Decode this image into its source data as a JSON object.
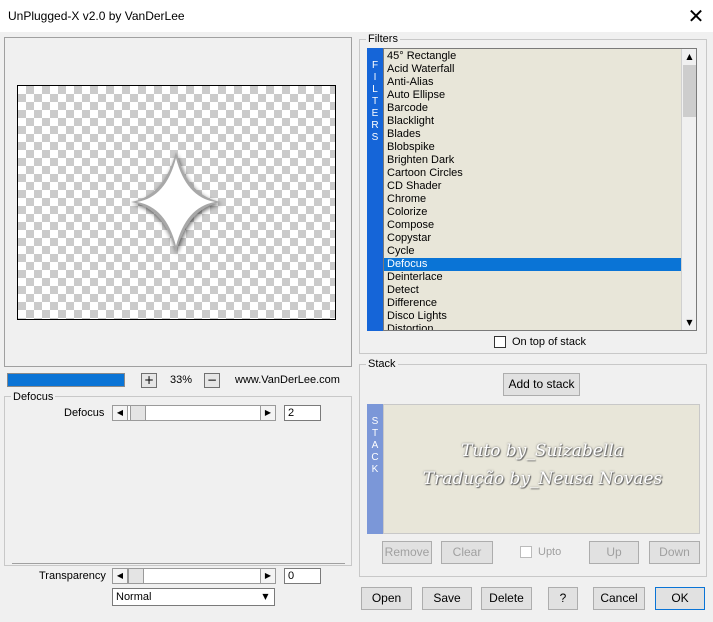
{
  "window": {
    "title": "UnPlugged-X v2.0 by VanDerLee",
    "close_glyph": "✕"
  },
  "preview": {
    "progress_percent": 100
  },
  "zoom": {
    "plus": "+",
    "minus": "−",
    "value": "33%"
  },
  "website": "www.VanDerLee.com",
  "defocus_group": {
    "label": "Defocus",
    "param_label": "Defocus",
    "param_value": "2",
    "slider_position": 0.02
  },
  "transparency": {
    "label": "Transparency",
    "value": "0",
    "slider_position": 0.0
  },
  "blend_mode": {
    "value": "Normal"
  },
  "filters_group": {
    "label": "Filters",
    "band_letters": [
      "F",
      "I",
      "L",
      "T",
      "E",
      "R",
      "S"
    ],
    "items": [
      "45° Rectangle",
      "Acid Waterfall",
      "Anti-Alias",
      "Auto Ellipse",
      "Barcode",
      "Blacklight",
      "Blades",
      "Blobspike",
      "Brighten Dark",
      "Cartoon Circles",
      "CD Shader",
      "Chrome",
      "Colorize",
      "Compose",
      "Copystar",
      "Cycle",
      "Defocus",
      "Deinterlace",
      "Detect",
      "Difference",
      "Disco Lights",
      "Distortion"
    ],
    "selected": "Defocus",
    "on_top_label": "On top of stack",
    "on_top_checked": false
  },
  "stack_group": {
    "label": "Stack",
    "band_letters": [
      "S",
      "T",
      "A",
      "C",
      "K"
    ],
    "add_label": "Add to stack",
    "watermark_line1": "Tuto by_Suizabella",
    "watermark_line2": "Tradução by_Neusa Novaes",
    "remove_label": "Remove",
    "clear_label": "Clear",
    "upto_label": "Upto",
    "up_label": "Up",
    "down_label": "Down"
  },
  "footer": {
    "open": "Open",
    "save": "Save",
    "delete": "Delete",
    "help": "?",
    "cancel": "Cancel",
    "ok": "OK"
  },
  "colors": {
    "accent": "#0a74d6",
    "filters_band": "#1565d8",
    "stack_band": "#7b97d8",
    "list_bg": "#e8e6d9"
  },
  "icons": {
    "left": "◀",
    "right": "▶",
    "down": "▼",
    "up": "▲"
  }
}
